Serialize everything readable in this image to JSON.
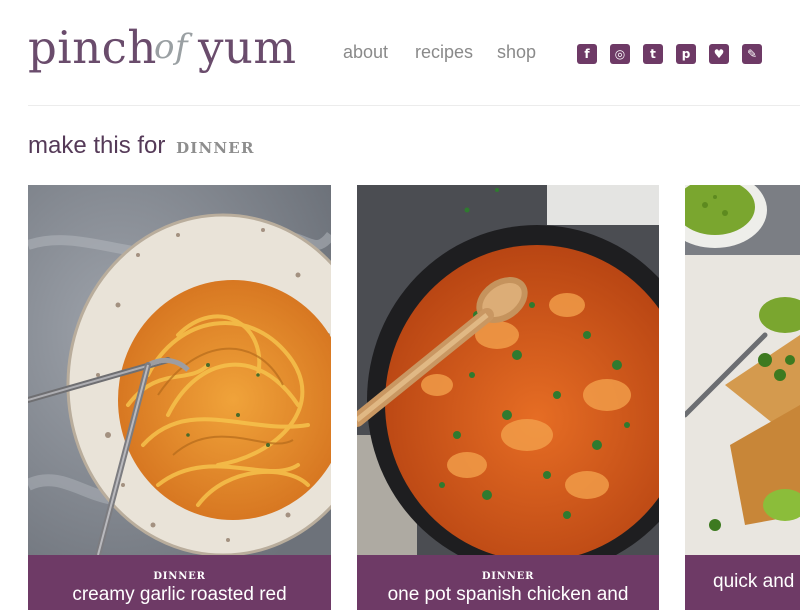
{
  "site": {
    "logo_left": "pinch",
    "logo_mid": "of",
    "logo_right": "yum"
  },
  "nav": {
    "items": [
      {
        "label": "about"
      },
      {
        "label": "recipes"
      },
      {
        "label": "shop"
      }
    ]
  },
  "social": {
    "icons": [
      {
        "name": "facebook-icon",
        "glyph": "f"
      },
      {
        "name": "instagram-icon",
        "glyph": "◎"
      },
      {
        "name": "twitter-icon",
        "glyph": "t"
      },
      {
        "name": "pinterest-icon",
        "glyph": "p"
      },
      {
        "name": "heart-icon",
        "glyph": "♥"
      },
      {
        "name": "pencil-icon",
        "glyph": "✎"
      }
    ]
  },
  "section": {
    "prefix": "make this for",
    "category": "DINNER"
  },
  "cards": [
    {
      "tag": "DINNER",
      "title": "creamy garlic roasted red"
    },
    {
      "tag": "DINNER",
      "title": "one pot spanish chicken and"
    },
    {
      "tag": "",
      "title": "quick and e"
    }
  ],
  "colors": {
    "brand": "#6e3a66",
    "nav_text": "#8a8a8a",
    "heading": "#553a58"
  }
}
